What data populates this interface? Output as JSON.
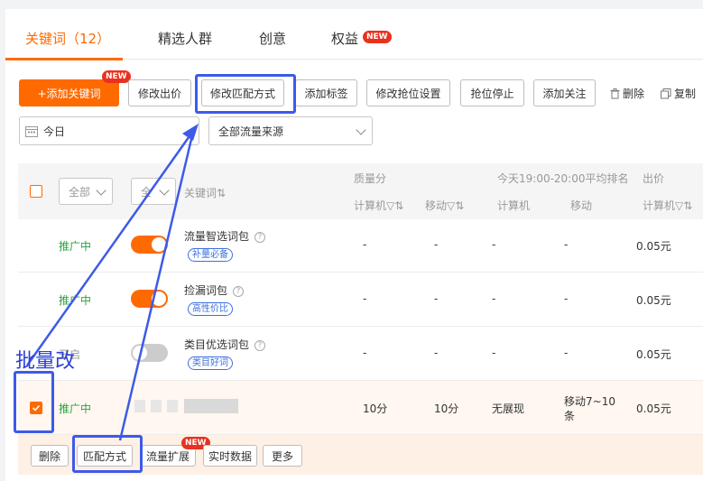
{
  "tabs": [
    {
      "label": "关键词（12）",
      "active": true
    },
    {
      "label": "精选人群",
      "active": false
    },
    {
      "label": "创意",
      "active": false
    },
    {
      "label": "权益",
      "active": false,
      "badge": "NEW"
    }
  ],
  "toolbar": {
    "add_keyword": "+添加关键词",
    "add_keyword_badge": "NEW",
    "modify_bid": "修改出价",
    "modify_match": "修改匹配方式",
    "add_tag": "添加标签",
    "modify_rank": "修改抢位设置",
    "stop_rank": "抢位停止",
    "add_follow": "添加关注",
    "delete": "删除",
    "copy": "复制"
  },
  "filters": {
    "date": "今日",
    "traffic": "全部流量来源"
  },
  "table": {
    "headers": {
      "all_status": "全部",
      "all_switch": "全",
      "keyword": "关键词⇅",
      "quality": "质量分",
      "quality_pc": "计算机▽⇅",
      "quality_mobile": "移动▽⇅",
      "rank_group": "今天19:00-20:00平均排名",
      "rank_pc": "计算机",
      "rank_mobile": "移动",
      "bid_group": "出价",
      "bid_pc": "计算机▽⇅"
    },
    "rows": [
      {
        "status": "推广中",
        "switch": "on",
        "name": "流量智选词包",
        "tag": "补量必备",
        "q_pc": "-",
        "q_mobile": "-",
        "r_pc": "-",
        "r_mobile": "-",
        "bid": "0.05元"
      },
      {
        "status": "推广中",
        "switch": "on",
        "name": "捡漏词包",
        "tag": "高性价比",
        "q_pc": "-",
        "q_mobile": "-",
        "r_pc": "-",
        "r_mobile": "-",
        "bid": "0.05元"
      },
      {
        "status": "开启",
        "switch": "off",
        "name": "类目优选词包",
        "tag": "类目好词",
        "q_pc": "-",
        "q_mobile": "-",
        "r_pc": "-",
        "r_mobile": "-",
        "bid": "0.05元"
      },
      {
        "status": "推广中",
        "switch": "",
        "name": "",
        "tag": "",
        "q_pc": "10分",
        "q_mobile": "10分",
        "r_pc": "无展现",
        "r_mobile_1": "移动7~10",
        "r_mobile_2": "条",
        "bid": "0.05元"
      }
    ]
  },
  "row_actions": {
    "delete": "删除",
    "match": "匹配方式",
    "expand": "流量扩展",
    "expand_badge": "NEW",
    "realtime": "实时数据",
    "more": "更多"
  },
  "annotation": {
    "text": "批量改",
    "color": "#3d5ae8"
  },
  "colors": {
    "accent": "#ff6a00",
    "status_green": "#2aa33a",
    "tag_blue": "#3d6fe0"
  }
}
